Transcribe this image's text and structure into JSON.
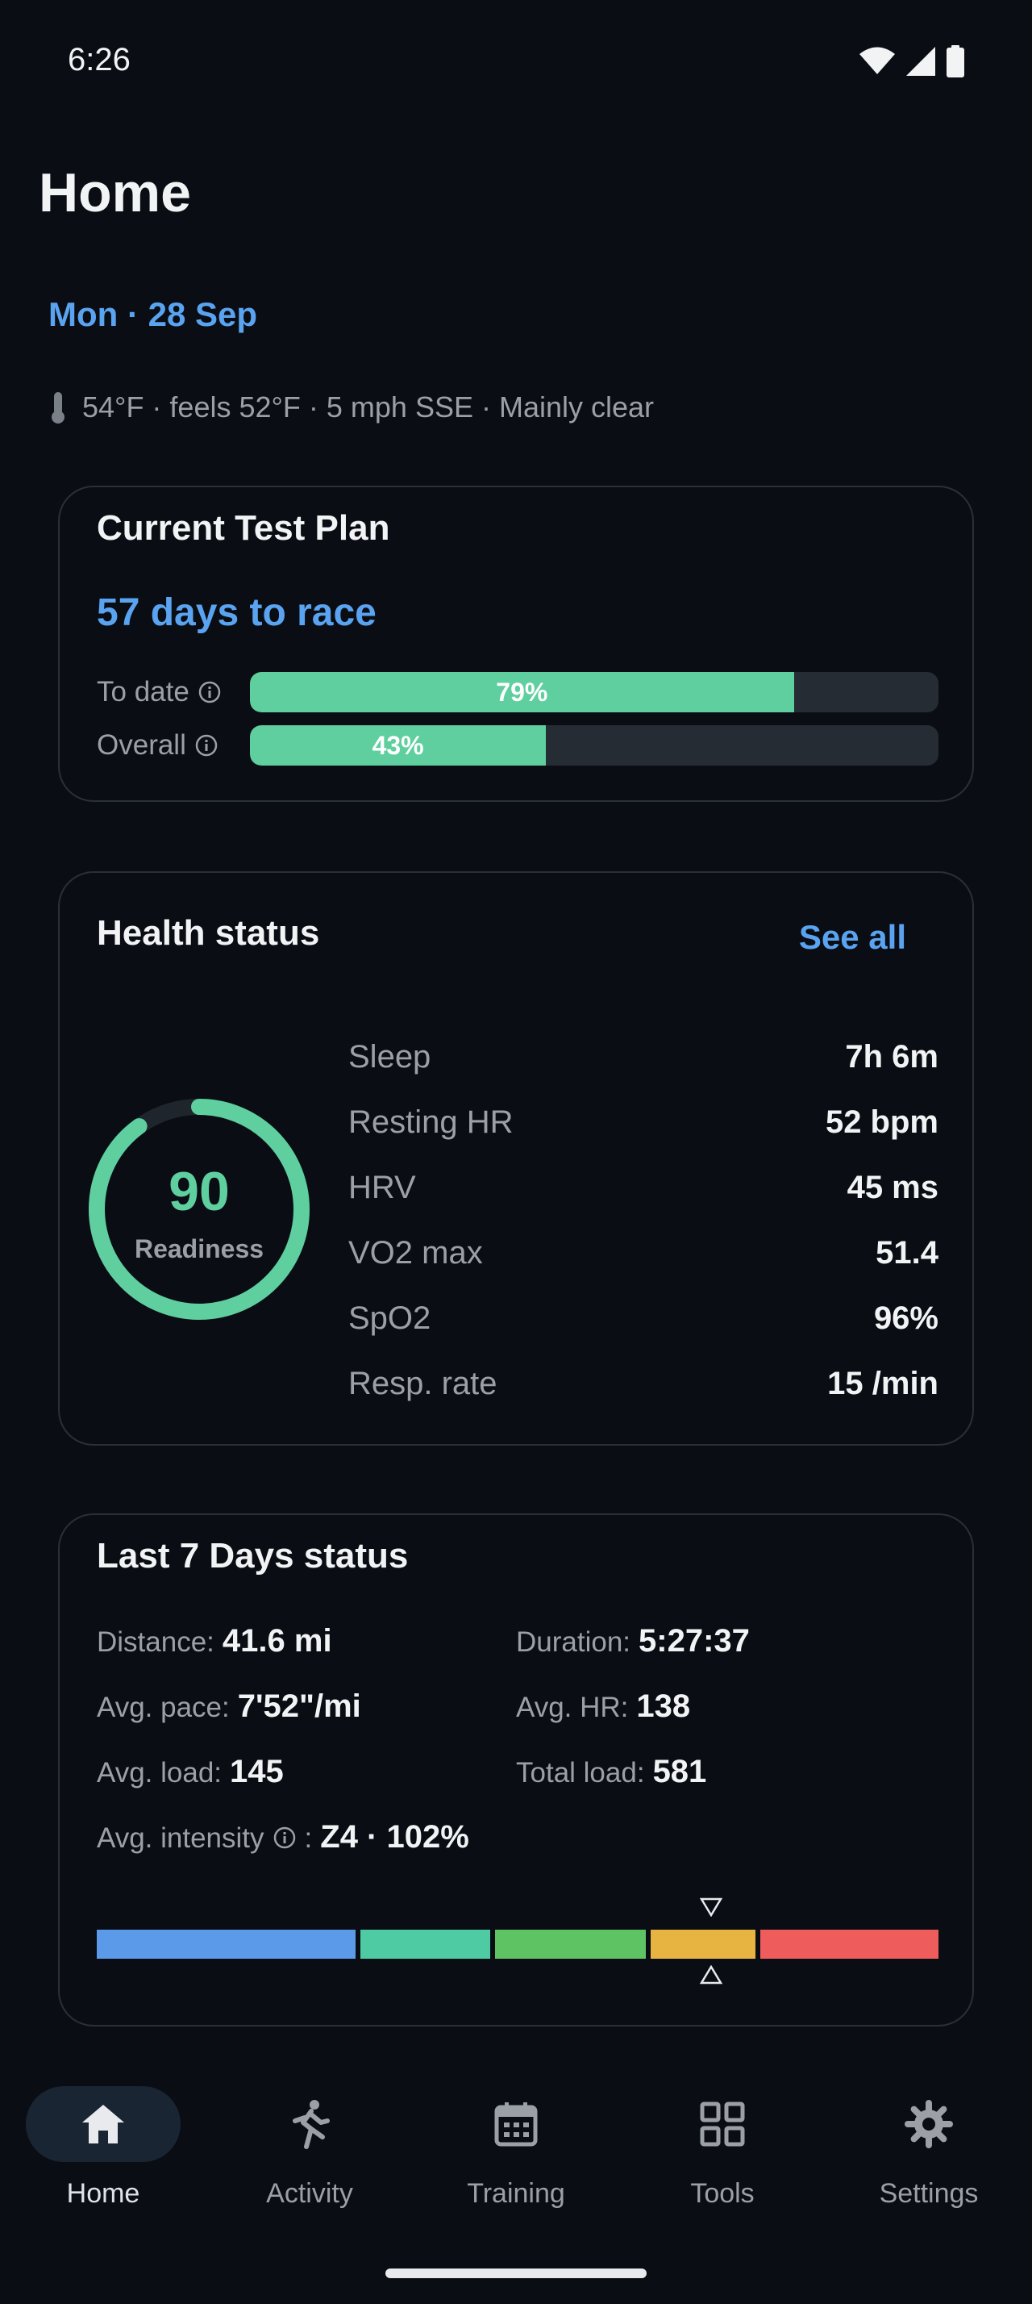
{
  "status_bar": {
    "time": "6:26",
    "icons": [
      "wifi-icon",
      "cell-signal-icon",
      "battery-icon"
    ]
  },
  "header": {
    "title": "Home",
    "date": "Mon · 28 Sep"
  },
  "weather": {
    "icon": "thermometer-icon",
    "text": "54°F · feels 52°F · 5 mph SSE · Mainly clear"
  },
  "plan": {
    "title": "Current Test Plan",
    "countdown": "57 days to race",
    "rows": [
      {
        "label": "To date",
        "percent_text": "79%",
        "value": 0.79
      },
      {
        "label": "Overall",
        "percent_text": "43%",
        "value": 0.43
      }
    ]
  },
  "health": {
    "title": "Health status",
    "see_all": "See all",
    "readiness": {
      "value": "90",
      "label": "Readiness",
      "fraction": 0.9
    },
    "metrics": [
      {
        "label": "Sleep",
        "value": "7h 6m"
      },
      {
        "label": "Resting HR",
        "value": "52 bpm"
      },
      {
        "label": "HRV",
        "value": "45 ms"
      },
      {
        "label": "VO2 max",
        "value": "51.4"
      },
      {
        "label": "SpO2",
        "value": "96%"
      },
      {
        "label": "Resp. rate",
        "value": "15 /min"
      }
    ]
  },
  "week": {
    "title": "Last 7 Days status",
    "distance": {
      "label": "Distance:",
      "value": "41.6 mi"
    },
    "duration": {
      "label": "Duration:",
      "value": "5:27:37"
    },
    "pace": {
      "label": "Avg. pace:",
      "value": "7'52\"/mi"
    },
    "hr": {
      "label": "Avg. HR:",
      "value": "138"
    },
    "avg_load": {
      "label": "Avg. load:",
      "value": "145"
    },
    "total_load": {
      "label": "Total load:",
      "value": "581"
    },
    "intensity": {
      "label": "Avg. intensity",
      "value": "Z4 · 102%"
    },
    "zones": [
      {
        "zone": "Z1",
        "color": "#5b9ae8",
        "fraction": 0.31
      },
      {
        "zone": "Z2",
        "color": "#4ecba3",
        "fraction": 0.16
      },
      {
        "zone": "Z3",
        "color": "#5ec463",
        "fraction": 0.185
      },
      {
        "zone": "Z4",
        "color": "#e8b441",
        "fraction": 0.13
      },
      {
        "zone": "Z5",
        "color": "#ef5c5c",
        "fraction": 0.215
      }
    ],
    "marker_position": 0.73
  },
  "nav": {
    "items": [
      {
        "label": "Home",
        "icon": "home-icon",
        "active": true
      },
      {
        "label": "Activity",
        "icon": "runner-icon",
        "active": false
      },
      {
        "label": "Training",
        "icon": "calendar-icon",
        "active": false
      },
      {
        "label": "Tools",
        "icon": "grid-icon",
        "active": false
      },
      {
        "label": "Settings",
        "icon": "gear-icon",
        "active": false
      }
    ]
  },
  "colors": {
    "accent": "#5aa3f0",
    "success": "#5fcf9f",
    "background": "#0a0e14"
  }
}
